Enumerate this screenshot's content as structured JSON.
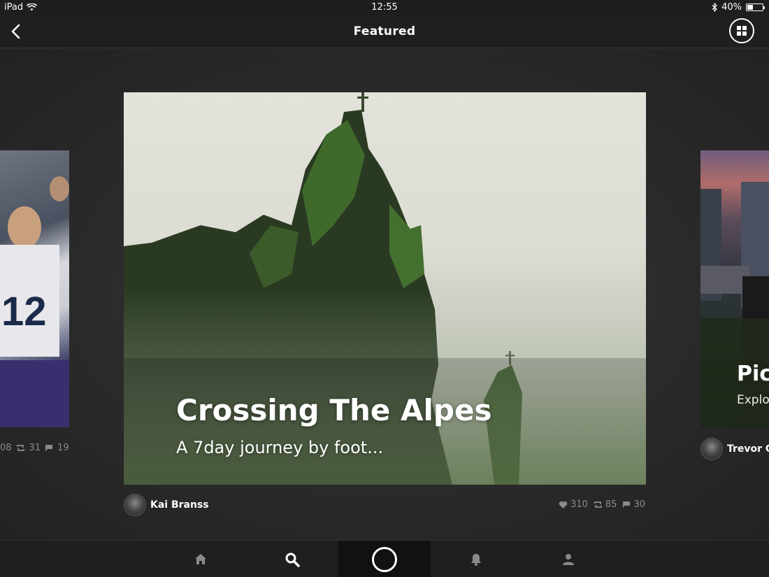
{
  "status_bar": {
    "device": "iPad",
    "time": "12:55",
    "battery": "40%",
    "battery_level": 0.4
  },
  "nav": {
    "title": "Featured"
  },
  "left_card": {
    "stats": {
      "likes_partial": "08",
      "reposts": "31",
      "comments": "19"
    }
  },
  "main_card": {
    "title": "Crossing The Alpes",
    "subtitle": "A 7day journey by foot...",
    "author": "Kai Branss",
    "likes": "310",
    "reposts": "85",
    "comments": "30"
  },
  "right_card": {
    "title_partial": "Pic",
    "subtitle_partial": "Explo",
    "author_partial": "Trevor G"
  },
  "tabs": [
    "home-icon",
    "search-icon",
    "camera-icon",
    "bell-icon",
    "profile-icon"
  ],
  "colors": {
    "background": "#262626",
    "bar": "#1f1f1f",
    "text": "#ffffff",
    "muted": "#8c8c8c"
  }
}
